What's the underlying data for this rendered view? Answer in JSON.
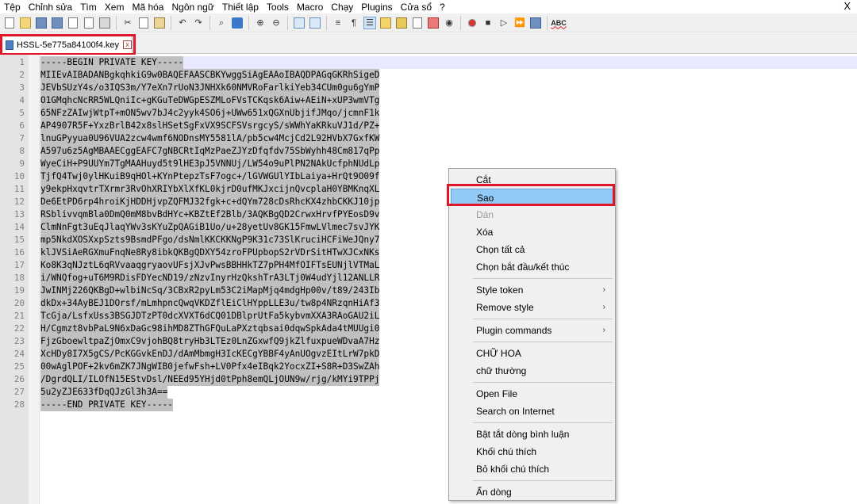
{
  "menubar": {
    "items": [
      "Tệp",
      "Chỉnh sửa",
      "Tìm",
      "Xem",
      "Mã hóa",
      "Ngôn ngữ",
      "Thiết lập",
      "Tools",
      "Macro",
      "Chạy",
      "Plugins",
      "Cửa sổ",
      "?"
    ],
    "close": "X"
  },
  "toolbar": {
    "spellcheck_label": "ABC"
  },
  "tab": {
    "filename": "HSSL-5e775a84100f4.key",
    "close_glyph": "x"
  },
  "editor": {
    "lines": [
      {
        "num": "1",
        "text": "-----BEGIN PRIVATE KEY-----"
      },
      {
        "num": "2",
        "text": "MIIEvAIBADANBgkqhkiG9w0BAQEFAASCBKYwggSiAgEAAoIBAQDPAGqGKRhSigeD"
      },
      {
        "num": "3",
        "text": "JEVbSUzY4s/o3IQS3m/Y7eXn7rUoN3JNHXk60NMVRoFarlkiYeb34CUm0gu6gYmP"
      },
      {
        "num": "4",
        "text": "O1GMqhcNcRR5WLQniIc+gKGuTeDWGpESZMLoFVsTCKqsk6Aiw+AEiN+xUP3wmVTg"
      },
      {
        "num": "5",
        "text": "65NFzZAIwjWtpT+mON5wv7bJ4c2yyk4SO6j+UWw651xQGXnUbjifJMqo/jcmnF1k"
      },
      {
        "num": "6",
        "text": "AP4907R5F+YxzBrlB42x8slHSetSgFxVX9SCFSVsrgcyS/sWWhYaKRkuVJ1d/PZ+"
      },
      {
        "num": "7",
        "text": "lnuGPyyua0U96VUA2zcw4wmf6NODnsMY5581lA/pb5cw4McjCd2L92HVbX7GxfKW"
      },
      {
        "num": "8",
        "text": "A597u6z5AgMBAAECggEAFC7gNBCRtIqMzPaeZJYzDfqfdv75SbWyhh48Cm817qPp"
      },
      {
        "num": "9",
        "text": "WyeCiH+P9UUYm7TgMAAHuyd5t9lHE3pJ5VNNUj/LW54o9uPlPN2NAkUcfphNUdLp"
      },
      {
        "num": "10",
        "text": "TjfQ4Twj0ylHKuiB9qHOl+KYnPtepzTsF7ogc+/lGVWGUlYIbLaiya+HrQt9O09f"
      },
      {
        "num": "11",
        "text": "y9ekpHxqvtrTXrmr3RvOhXRIYbXlXfKL0kjrD0ufMKJxcijnQvcplaH0YBMKnqXL"
      },
      {
        "num": "12",
        "text": "De6EtPD6rp4hroiKjHDDHjvpZQFMJ32fgk+c+dQYm728cDsRhcKX4zhbCKKJ10jp"
      },
      {
        "num": "13",
        "text": "RSblivvqmBla0DmQ0mM8bvBdHYc+KBZtEf2Blb/3AQKBgQD2CrwxHrvfPYEosD9v"
      },
      {
        "num": "14",
        "text": "ClmNnFgt3uEqJlaqYWv3sKYuZpQAGiB1Uo/u+28yetUv8GK15FmwLVlmec7svJYK"
      },
      {
        "num": "15",
        "text": "mp5NkdXOSXxpSzts9BsmdPFgo/dsNmlKKCKKNgP9K31c73SlKruciHCFiWeJQny7"
      },
      {
        "num": "16",
        "text": "klJVSiAeRGXmuFnqNe8Ry8ibkQKBgQDXY54zroFPUpbopS2rVDrSitHTwXJCxNKs"
      },
      {
        "num": "17",
        "text": "Ko8K3qNJztL6qRVvaaqgryaovUFsjXJvPwsBBHHkTZ7pPH4MfOIFTsEUNjlVTMaL"
      },
      {
        "num": "18",
        "text": "i/WNQfog+uT6M9RDisFDYecND19/zNzvInyrHzQkshTrA3LTj0W4udYjl12ANLLR"
      },
      {
        "num": "19",
        "text": "JwINMj226QKBgD+wlbiNcSq/3CBxR2pyLm53C2iMapMjq4mdgHp00v/t89/243Ib"
      },
      {
        "num": "20",
        "text": "dkDx+34AyBEJ1DOrsf/mLmhpncQwqVKDZflEiClHYppLLE3u/tw8p4NRzqnHiAf3"
      },
      {
        "num": "21",
        "text": "TcGja/LsfxUss3BSGJDTzPT0dcXVXT6dCQ01DBlprUtFa5kybvmXXA3RAoGAU2iL"
      },
      {
        "num": "22",
        "text": "H/Cgmzt8vbPaL9N6xDaGc98ihMD8ZThGFQuLaPXztqbsai0dqwSpkAda4tMUUgi0"
      },
      {
        "num": "23",
        "text": "FjzGboewltpaZjOmxC9vjohBQ8tryHb3LTEz0LnZGxwfQ9jkZlfuxpueWDvaA7Hz"
      },
      {
        "num": "24",
        "text": "XcHDy8I7X5gCS/PcKGGvkEnDJ/dAmMbmgH3IcKECgYBBF4yAnUOgvzEItLrW7pkD"
      },
      {
        "num": "25",
        "text": "00wAglPOF+2kv6mZK7JNgWIB0jefwFsh+LV0Pfx4eIBqk2YocxZI+S8R+D3SwZAh"
      },
      {
        "num": "26",
        "text": "/DgrdQLI/ILOfN15EStvDsl/NEEd95YHjd0tPph8emQLjOUN9w/rjg/kMYi9TPPj"
      },
      {
        "num": "27",
        "text": "5u2yZJE633fDqQJzGl3h3A=="
      },
      {
        "num": "28",
        "text": "-----END PRIVATE KEY-----"
      }
    ]
  },
  "context_menu": {
    "items": [
      {
        "label": "Cắt",
        "name": "cm-item-cut"
      },
      {
        "label": "Sao",
        "name": "cm-item-copy",
        "selected": true
      },
      {
        "label": "Dán",
        "name": "cm-item-paste",
        "disabled": true
      },
      {
        "label": "Xóa",
        "name": "cm-item-delete"
      },
      {
        "label": "Chọn tất cả",
        "name": "cm-item-select-all"
      },
      {
        "label": "Chọn bắt đầu/kết thúc",
        "name": "cm-item-select-begin-end"
      },
      {
        "separator": true
      },
      {
        "label": "Style token",
        "name": "cm-item-style-token",
        "submenu": true
      },
      {
        "label": "Remove style",
        "name": "cm-item-remove-style",
        "submenu": true
      },
      {
        "separator": true
      },
      {
        "label": "Plugin commands",
        "name": "cm-item-plugin-commands",
        "submenu": true
      },
      {
        "separator": true
      },
      {
        "label": "CHỮ HOA",
        "name": "cm-item-uppercase"
      },
      {
        "label": "chữ thường",
        "name": "cm-item-lowercase"
      },
      {
        "separator": true
      },
      {
        "label": "Open File",
        "name": "cm-item-open-file"
      },
      {
        "label": "Search on Internet",
        "name": "cm-item-search-internet"
      },
      {
        "separator": true
      },
      {
        "label": "Bật tắt dòng bình luận",
        "name": "cm-item-toggle-line-comment"
      },
      {
        "label": "Khối chú thích",
        "name": "cm-item-block-comment"
      },
      {
        "label": "Bỏ khối chú thích",
        "name": "cm-item-block-uncomment"
      },
      {
        "separator": true
      },
      {
        "label": "Ẩn dòng",
        "name": "cm-item-hide-lines"
      }
    ],
    "submenu_arrow": "›",
    "highlight_color": "#e0162a"
  }
}
